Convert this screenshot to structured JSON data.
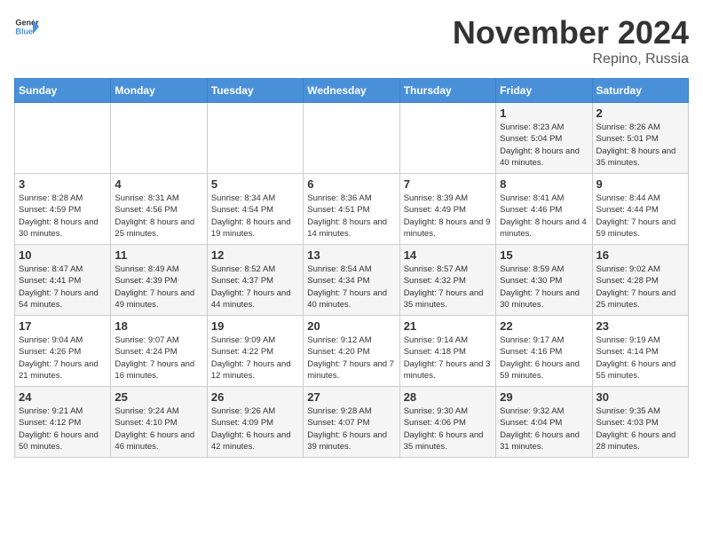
{
  "header": {
    "logo_line1": "General",
    "logo_line2": "Blue",
    "month_title": "November 2024",
    "location": "Repino, Russia"
  },
  "weekdays": [
    "Sunday",
    "Monday",
    "Tuesday",
    "Wednesday",
    "Thursday",
    "Friday",
    "Saturday"
  ],
  "weeks": [
    [
      {
        "day": "",
        "info": ""
      },
      {
        "day": "",
        "info": ""
      },
      {
        "day": "",
        "info": ""
      },
      {
        "day": "",
        "info": ""
      },
      {
        "day": "",
        "info": ""
      },
      {
        "day": "1",
        "info": "Sunrise: 8:23 AM\nSunset: 5:04 PM\nDaylight: 8 hours and 40 minutes."
      },
      {
        "day": "2",
        "info": "Sunrise: 8:26 AM\nSunset: 5:01 PM\nDaylight: 8 hours and 35 minutes."
      }
    ],
    [
      {
        "day": "3",
        "info": "Sunrise: 8:28 AM\nSunset: 4:59 PM\nDaylight: 8 hours and 30 minutes."
      },
      {
        "day": "4",
        "info": "Sunrise: 8:31 AM\nSunset: 4:56 PM\nDaylight: 8 hours and 25 minutes."
      },
      {
        "day": "5",
        "info": "Sunrise: 8:34 AM\nSunset: 4:54 PM\nDaylight: 8 hours and 19 minutes."
      },
      {
        "day": "6",
        "info": "Sunrise: 8:36 AM\nSunset: 4:51 PM\nDaylight: 8 hours and 14 minutes."
      },
      {
        "day": "7",
        "info": "Sunrise: 8:39 AM\nSunset: 4:49 PM\nDaylight: 8 hours and 9 minutes."
      },
      {
        "day": "8",
        "info": "Sunrise: 8:41 AM\nSunset: 4:46 PM\nDaylight: 8 hours and 4 minutes."
      },
      {
        "day": "9",
        "info": "Sunrise: 8:44 AM\nSunset: 4:44 PM\nDaylight: 7 hours and 59 minutes."
      }
    ],
    [
      {
        "day": "10",
        "info": "Sunrise: 8:47 AM\nSunset: 4:41 PM\nDaylight: 7 hours and 54 minutes."
      },
      {
        "day": "11",
        "info": "Sunrise: 8:49 AM\nSunset: 4:39 PM\nDaylight: 7 hours and 49 minutes."
      },
      {
        "day": "12",
        "info": "Sunrise: 8:52 AM\nSunset: 4:37 PM\nDaylight: 7 hours and 44 minutes."
      },
      {
        "day": "13",
        "info": "Sunrise: 8:54 AM\nSunset: 4:34 PM\nDaylight: 7 hours and 40 minutes."
      },
      {
        "day": "14",
        "info": "Sunrise: 8:57 AM\nSunset: 4:32 PM\nDaylight: 7 hours and 35 minutes."
      },
      {
        "day": "15",
        "info": "Sunrise: 8:59 AM\nSunset: 4:30 PM\nDaylight: 7 hours and 30 minutes."
      },
      {
        "day": "16",
        "info": "Sunrise: 9:02 AM\nSunset: 4:28 PM\nDaylight: 7 hours and 25 minutes."
      }
    ],
    [
      {
        "day": "17",
        "info": "Sunrise: 9:04 AM\nSunset: 4:26 PM\nDaylight: 7 hours and 21 minutes."
      },
      {
        "day": "18",
        "info": "Sunrise: 9:07 AM\nSunset: 4:24 PM\nDaylight: 7 hours and 16 minutes."
      },
      {
        "day": "19",
        "info": "Sunrise: 9:09 AM\nSunset: 4:22 PM\nDaylight: 7 hours and 12 minutes."
      },
      {
        "day": "20",
        "info": "Sunrise: 9:12 AM\nSunset: 4:20 PM\nDaylight: 7 hours and 7 minutes."
      },
      {
        "day": "21",
        "info": "Sunrise: 9:14 AM\nSunset: 4:18 PM\nDaylight: 7 hours and 3 minutes."
      },
      {
        "day": "22",
        "info": "Sunrise: 9:17 AM\nSunset: 4:16 PM\nDaylight: 6 hours and 59 minutes."
      },
      {
        "day": "23",
        "info": "Sunrise: 9:19 AM\nSunset: 4:14 PM\nDaylight: 6 hours and 55 minutes."
      }
    ],
    [
      {
        "day": "24",
        "info": "Sunrise: 9:21 AM\nSunset: 4:12 PM\nDaylight: 6 hours and 50 minutes."
      },
      {
        "day": "25",
        "info": "Sunrise: 9:24 AM\nSunset: 4:10 PM\nDaylight: 6 hours and 46 minutes."
      },
      {
        "day": "26",
        "info": "Sunrise: 9:26 AM\nSunset: 4:09 PM\nDaylight: 6 hours and 42 minutes."
      },
      {
        "day": "27",
        "info": "Sunrise: 9:28 AM\nSunset: 4:07 PM\nDaylight: 6 hours and 39 minutes."
      },
      {
        "day": "28",
        "info": "Sunrise: 9:30 AM\nSunset: 4:06 PM\nDaylight: 6 hours and 35 minutes."
      },
      {
        "day": "29",
        "info": "Sunrise: 9:32 AM\nSunset: 4:04 PM\nDaylight: 6 hours and 31 minutes."
      },
      {
        "day": "30",
        "info": "Sunrise: 9:35 AM\nSunset: 4:03 PM\nDaylight: 6 hours and 28 minutes."
      }
    ]
  ]
}
